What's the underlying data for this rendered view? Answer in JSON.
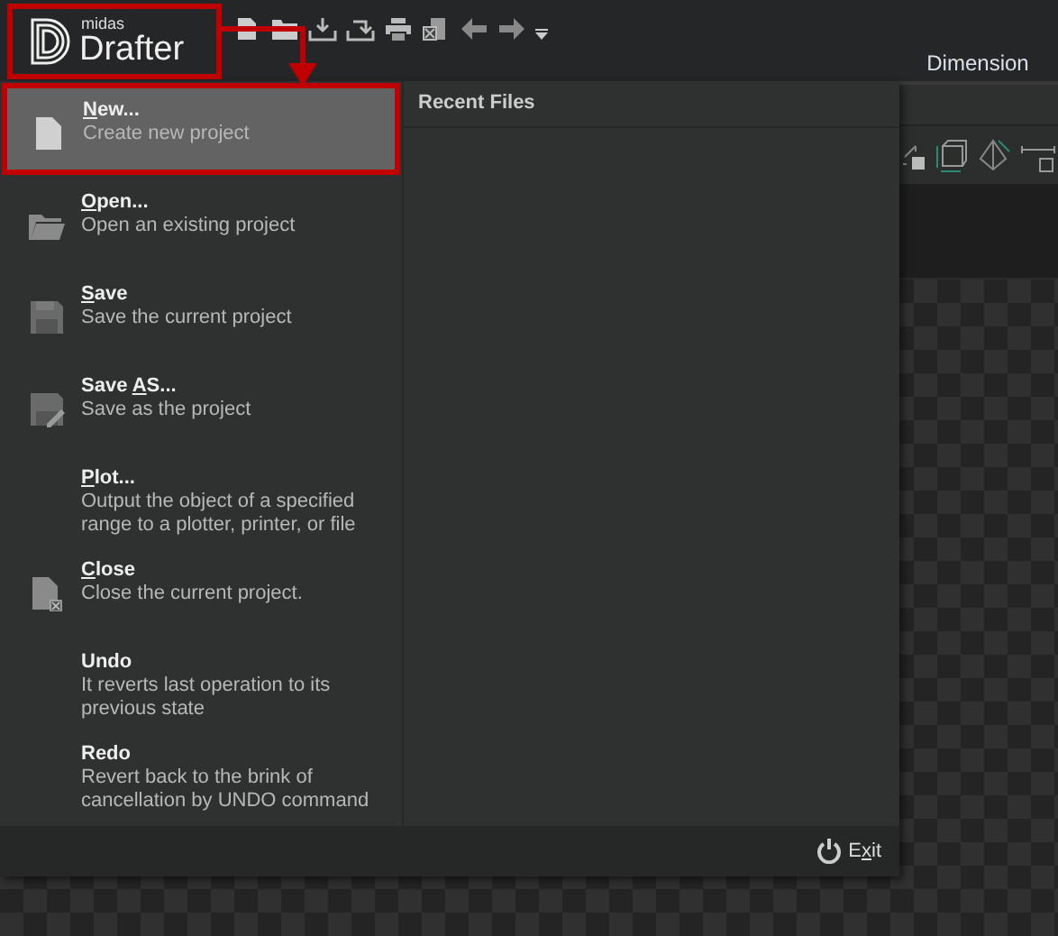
{
  "app": {
    "logo_small": "midas",
    "logo_large": "Drafter"
  },
  "ribbon_tab": {
    "label": "Dimension"
  },
  "menu": {
    "items": [
      {
        "kind": "new",
        "title": [
          {
            "text": "N",
            "underlined": true
          },
          {
            "text": "ew...",
            "underlined": false
          }
        ],
        "description": "Create new project",
        "selected": true
      },
      {
        "kind": "open",
        "title": [
          {
            "text": "O",
            "underlined": true
          },
          {
            "text": "pen...",
            "underlined": false
          }
        ],
        "description": "Open an existing project",
        "selected": false
      },
      {
        "kind": "save",
        "title": [
          {
            "text": "S",
            "underlined": true
          },
          {
            "text": "ave",
            "underlined": false
          }
        ],
        "description": "Save the current project",
        "selected": false
      },
      {
        "kind": "saveas",
        "title": [
          {
            "text": "Save ",
            "underlined": false
          },
          {
            "text": "A",
            "underlined": true
          },
          {
            "text": "S...",
            "underlined": false
          }
        ],
        "description": "Save as the project",
        "selected": false
      },
      {
        "kind": "none",
        "title": [
          {
            "text": "P",
            "underlined": true
          },
          {
            "text": "lot...",
            "underlined": false
          }
        ],
        "description": "Output the object of a specified range to a plotter, printer, or file",
        "selected": false
      },
      {
        "kind": "close",
        "title": [
          {
            "text": "C",
            "underlined": true
          },
          {
            "text": "lose",
            "underlined": false
          }
        ],
        "description": "Close the current project.",
        "selected": false
      },
      {
        "kind": "none",
        "title": [
          {
            "text": "Undo",
            "underlined": false
          }
        ],
        "description": "It reverts last operation to its previous state",
        "selected": false
      },
      {
        "kind": "none",
        "title": [
          {
            "text": "Redo",
            "underlined": false
          }
        ],
        "description": "Revert back to the brink of cancellation by UNDO command",
        "selected": false
      }
    ],
    "recent_heading": "Recent Files",
    "exit": {
      "label": [
        {
          "text": "E",
          "underlined": false
        },
        {
          "text": "x",
          "underlined": true
        },
        {
          "text": "it",
          "underlined": false
        }
      ]
    }
  }
}
